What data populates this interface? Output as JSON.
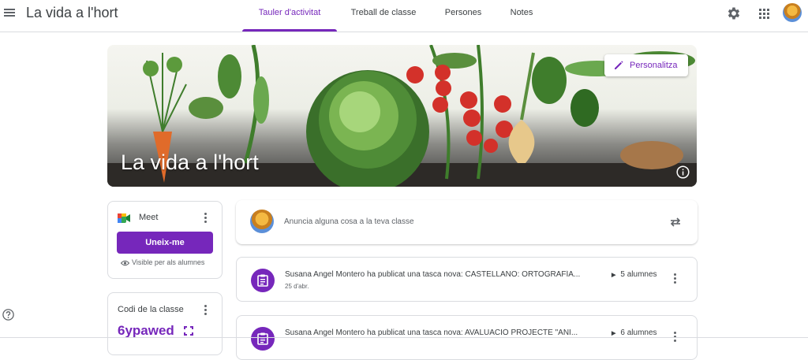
{
  "app": {
    "title": "La vida a l'hort"
  },
  "tabs": [
    {
      "label": "Tauler d'activitat",
      "active": true
    },
    {
      "label": "Treball de classe",
      "active": false
    },
    {
      "label": "Persones",
      "active": false
    },
    {
      "label": "Notes",
      "active": false
    }
  ],
  "header_icons": [
    "menu-icon",
    "settings-icon",
    "apps-grid-icon",
    "account-avatar"
  ],
  "banner": {
    "title": "La vida a l'hort",
    "customize_label": "Personalitza",
    "info_icon": "info-icon"
  },
  "meet": {
    "label": "Meet",
    "join_label": "Uneix-me",
    "visibility_text": "Visible per als alumnes"
  },
  "class_code": {
    "label": "Codi de la classe",
    "value": "6ypawed"
  },
  "announce": {
    "placeholder": "Anuncia alguna cosa a la teva classe"
  },
  "posts": [
    {
      "text": "Susana Angel Montero ha publicat una tasca nova: CASTELLANO: ORTOGRAFÍA...",
      "date": "25 d'abr.",
      "count": "5 alumnes"
    },
    {
      "text": "Susana Angel Montero ha publicat una tasca nova: AVALUACIÓ PROJECTE \"ANI...",
      "date": "",
      "count": "6 alumnes"
    }
  ],
  "colors": {
    "accent": "#7627bb",
    "text": "#3c4043",
    "muted": "#5f6368"
  }
}
